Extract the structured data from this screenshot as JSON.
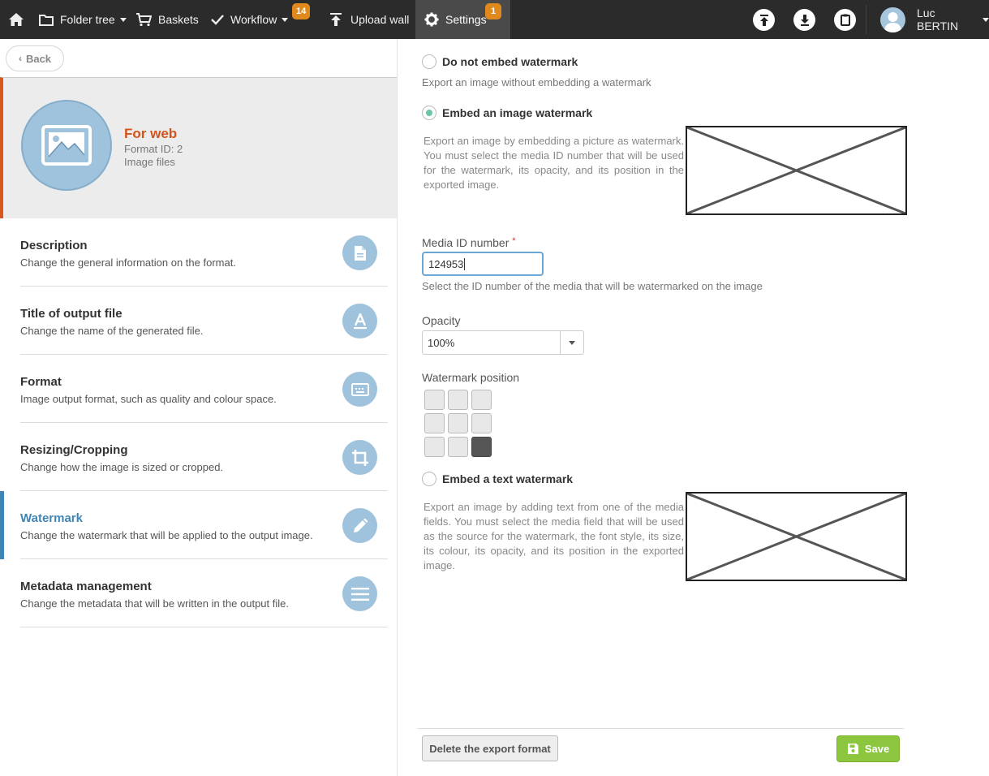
{
  "topbar": {
    "nav": [
      {
        "label": ""
      },
      {
        "label": "Folder tree"
      },
      {
        "label": "Baskets"
      },
      {
        "label": "Workflow",
        "badge": "14"
      },
      {
        "label": "Upload wall"
      },
      {
        "label": "Settings",
        "badge": "1"
      }
    ],
    "user_name": "Luc BERTIN",
    "accent_color": "#e08a1e"
  },
  "sidebar": {
    "back_label": "Back",
    "format": {
      "title": "For web",
      "format_id": "Format ID: 2",
      "type": "Image files"
    },
    "items": [
      {
        "title": "Description",
        "desc": "Change the general information on the format.",
        "icon": "document-icon"
      },
      {
        "title": "Title of output file",
        "desc": "Change the name of the generated file.",
        "icon": "letter-a-icon"
      },
      {
        "title": "Format",
        "desc": "Image output format, such as quality and colour space.",
        "icon": "keyboard-icon"
      },
      {
        "title": "Resizing/Cropping",
        "desc": "Change how the image is sized or cropped.",
        "icon": "crop-icon"
      },
      {
        "title": "Watermark",
        "desc": "Change the watermark that will be applied to the output image.",
        "icon": "pencil-icon"
      },
      {
        "title": "Metadata management",
        "desc": "Change the metadata that will be written in the output file.",
        "icon": "list-icon"
      }
    ]
  },
  "main": {
    "option_none": {
      "label": "Do not embed watermark",
      "help": "Export an image without embedding a watermark"
    },
    "option_image": {
      "label": "Embed an image watermark",
      "help": "Export an image by embedding a picture as watermark. You must select the media ID number that will be used for the watermark, its opacity, and its position in the exported image."
    },
    "media_id": {
      "label": "Media ID number",
      "required_mark": "*",
      "value": "124953",
      "help": "Select the ID number of the media that will be watermarked on the image"
    },
    "opacity": {
      "label": "Opacity",
      "value": "100%"
    },
    "position": {
      "label": "Watermark position",
      "selected": "bottom-right"
    },
    "option_text": {
      "label": "Embed a text watermark",
      "help": "Export an image by adding text from one of the media fields. You must select the media field that will be used as the source for the watermark, the font style, its size, its colour, its opacity, and its position in the exported image."
    },
    "delete_label": "Delete the export format",
    "save_label": "Save"
  }
}
